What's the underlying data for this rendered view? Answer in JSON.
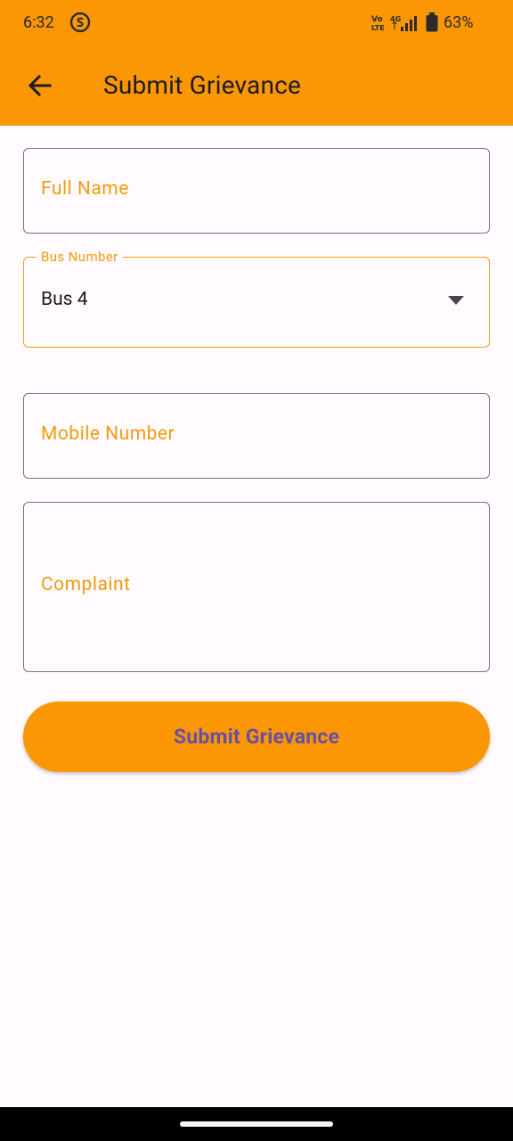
{
  "status_bar": {
    "time": "6:32",
    "battery_percent": "63%",
    "network": "VoLTE 4G",
    "icons": [
      "app-notification-icon",
      "volte-icon",
      "signal-icon",
      "battery-icon"
    ]
  },
  "app_bar": {
    "title": "Submit Grievance",
    "back_icon": "arrow-left-icon",
    "background_color": "#FB9604"
  },
  "form": {
    "full_name": {
      "label": "Full Name",
      "value": ""
    },
    "bus_number": {
      "label": "Bus Number",
      "selected": "Bus 4"
    },
    "mobile_number": {
      "label": "Mobile Number",
      "value": ""
    },
    "complaint": {
      "label": "Complaint",
      "value": ""
    },
    "submit_label": "Submit Grievance"
  },
  "colors": {
    "accent": "#FB9604",
    "label": "#F39B10",
    "button_text": "#6750A4",
    "background": "#FFFBFE"
  }
}
